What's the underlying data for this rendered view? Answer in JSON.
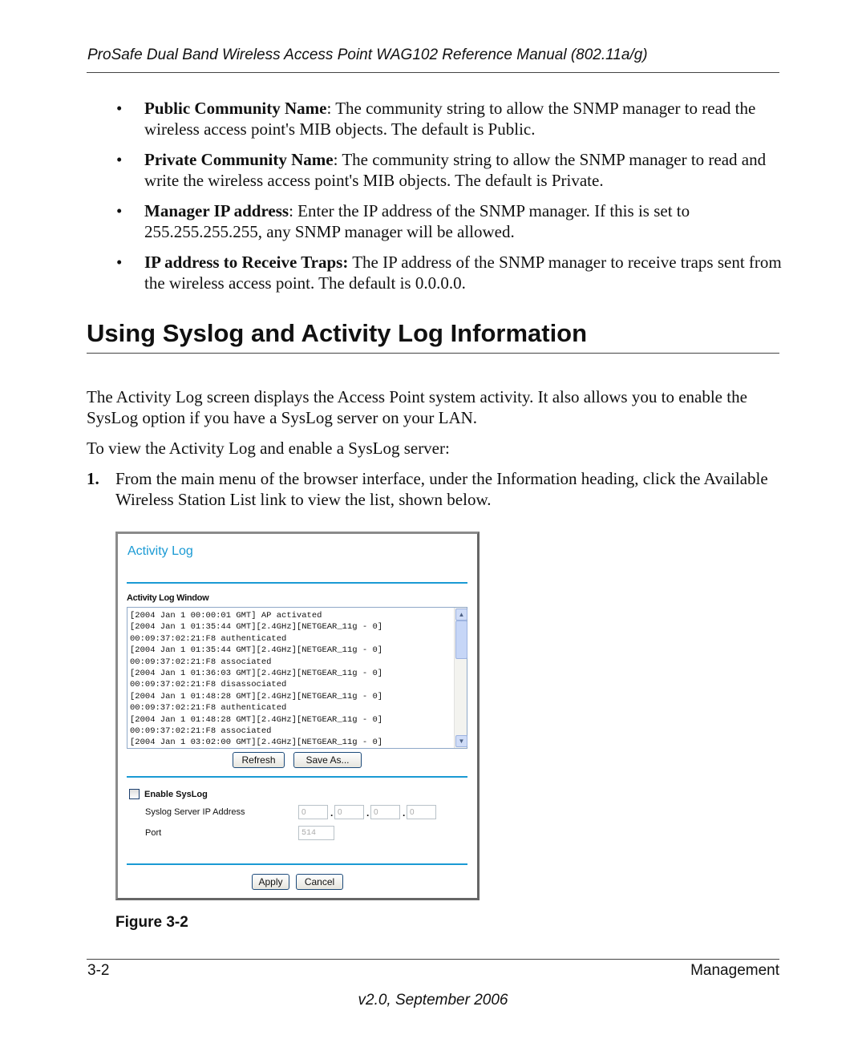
{
  "header": {
    "title": "ProSafe Dual Band Wireless Access Point WAG102 Reference Manual (802.11a/g)"
  },
  "bullets": [
    {
      "term": "Public Community Name",
      "text": ": The community string to allow the SNMP manager to read the wireless access point's MIB objects. The default is Public."
    },
    {
      "term": "Private Community Name",
      "text": ": The community string to allow the SNMP manager to read and write the wireless access point's MIB objects. The default is Private."
    },
    {
      "term": "Manager IP address",
      "text": ": Enter the IP address of the SNMP manager. If this is set to 255.255.255.255, any SNMP manager will be allowed."
    },
    {
      "term": "IP address to Receive Traps:",
      "text": " The IP address of the SNMP manager to receive traps sent from the wireless access point. The default is 0.0.0.0."
    }
  ],
  "section": {
    "heading": "Using Syslog and Activity Log Information"
  },
  "paragraphs": [
    "The Activity Log screen displays the Access Point system activity. It also allows you to enable the SysLog option if you have a SysLog server on your LAN.",
    "To view the Activity Log and enable a SysLog server:"
  ],
  "steps": [
    {
      "num": "1.",
      "text": "From the main menu of the browser interface, under the Information heading, click the Available Wireless Station List link to view the list, shown below."
    }
  ],
  "figure": {
    "title": "Activity Log",
    "log_window_label": "Activity Log Window",
    "log": "[2004 Jan 1 00:00:01 GMT] AP activated\n[2004 Jan 1 01:35:44 GMT][2.4GHz][NETGEAR_11g - 0]\n00:09:37:02:21:F8 authenticated\n[2004 Jan 1 01:35:44 GMT][2.4GHz][NETGEAR_11g - 0]\n00:09:37:02:21:F8 associated\n[2004 Jan 1 01:36:03 GMT][2.4GHz][NETGEAR_11g - 0]\n00:09:37:02:21:F8 disassociated\n[2004 Jan 1 01:48:28 GMT][2.4GHz][NETGEAR_11g - 0]\n00:09:37:02:21:F8 authenticated\n[2004 Jan 1 01:48:28 GMT][2.4GHz][NETGEAR_11g - 0]\n00:09:37:02:21:F8 associated\n[2004 Jan 1 03:02:00 GMT][2.4GHz][NETGEAR_11g - 0]",
    "refresh": "Refresh",
    "save_as": "Save As...",
    "enable_syslog": "Enable SysLog",
    "enable_syslog_checked": false,
    "server_ip_label": "Syslog Server IP Address",
    "ip": [
      "0",
      "0",
      "0",
      "0"
    ],
    "port_label": "Port",
    "port": "514",
    "apply": "Apply",
    "cancel": "Cancel",
    "accent": "#1a9ad4"
  },
  "caption": "Figure 3-2",
  "footer": {
    "page": "3-2",
    "section": "Management",
    "version": "v2.0, September 2006"
  }
}
